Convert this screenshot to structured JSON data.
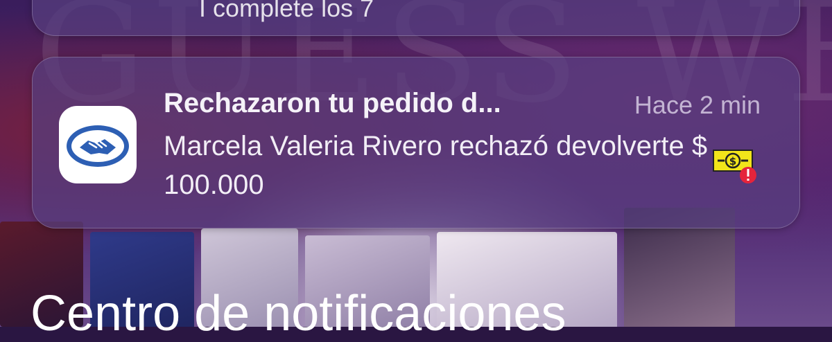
{
  "previous_notification": {
    "clipped_text": "I complete los 7"
  },
  "notification": {
    "app_icon": "mercado-pago-handshake-icon",
    "title": "Rechazaron tu pedido d...",
    "time": "Hace 2 min",
    "body": "Marcela Valeria Rivero rechazó devolverte $ 100.000",
    "badge_icon": "money-alert-icon"
  },
  "section_title": "Centro de notificaciones",
  "colors": {
    "app_icon_blue": "#2d5fb4",
    "badge_yellow": "#f2e51a",
    "alert_red": "#e5243b"
  }
}
